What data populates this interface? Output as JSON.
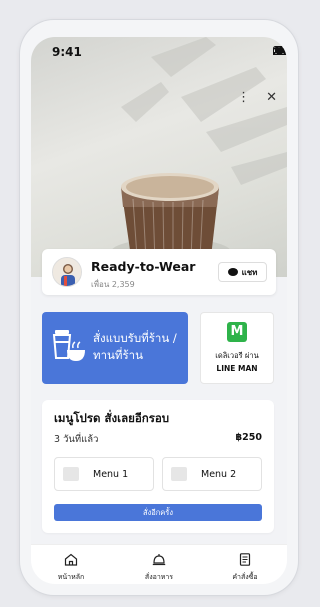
{
  "status_bar": {
    "time": "9:41"
  },
  "top_actions": {
    "more": "⋮",
    "close": "✕"
  },
  "store": {
    "name": "Ready-to-Wear",
    "friends": "เพื่อน 2,359",
    "chat_label": "แชท"
  },
  "order_options": {
    "pickup_label": "สั่งแบบรับที่ร้าน / ทานที่ร้าน",
    "delivery_logo": "M",
    "delivery_line1": "เดลิเวอรี ผ่าน",
    "delivery_line2": "LINE MAN"
  },
  "reorder": {
    "title": "เมนูโปรด สั่งเลยอีกรอบ",
    "when": "3 วันที่แล้ว",
    "price": "฿250",
    "items": [
      {
        "label": "Menu 1"
      },
      {
        "label": "Menu 2"
      }
    ],
    "button_label": "สั่งอีกครั้ง"
  },
  "bottom_nav": [
    {
      "label": "หน้าหลัก",
      "icon": "home-icon"
    },
    {
      "label": "สั่งอาหาร",
      "icon": "order-icon"
    },
    {
      "label": "คำสั่งซื้อ",
      "icon": "orders-list-icon"
    }
  ],
  "colors": {
    "accent": "#4a76d9",
    "line_man": "#2eb34a"
  }
}
